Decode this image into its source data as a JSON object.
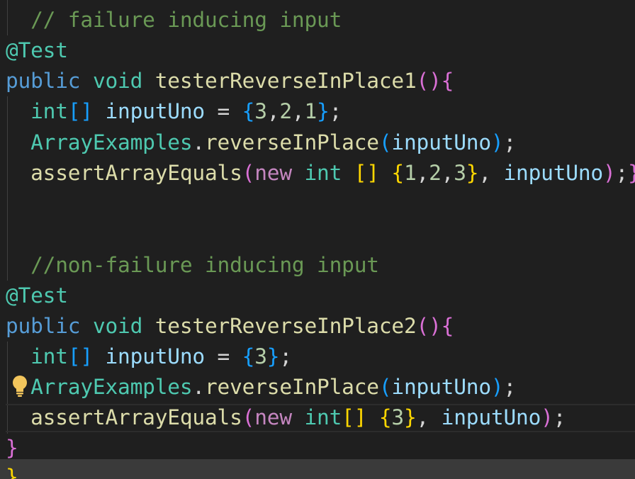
{
  "code": {
    "comment_failure": "// failure inducing input",
    "annotation": "@Test",
    "kw_public": "public",
    "kw_void": "void",
    "method1": "testerReverseInPlace1",
    "kw_int": "int",
    "var_input": "inputUno",
    "eq": "=",
    "class_name": "ArrayExamples",
    "method_reverse": "reverseInPlace",
    "method_assert": "assertArrayEquals",
    "kw_new": "new",
    "comment_nonfailure": "//non-failure inducing input",
    "method2": "testerReverseInPlace2",
    "nums1": [
      "3",
      "2",
      "1"
    ],
    "nums_expected1": [
      "1",
      "2",
      "3"
    ],
    "nums2": [
      "3"
    ],
    "nums_expected2": [
      "3"
    ]
  },
  "colors": {
    "background": "#1f1f1f",
    "comment": "#6a9955",
    "keyword": "#569cd6",
    "type": "#4ec9b0",
    "function": "#dcdcaa",
    "variable": "#9cdcfe",
    "number": "#b5cea8",
    "bracket_gold": "#ffd700",
    "bracket_purple": "#da70d6",
    "bracket_blue": "#179fff"
  },
  "icons": {
    "lightbulb": "lightbulb-icon"
  }
}
